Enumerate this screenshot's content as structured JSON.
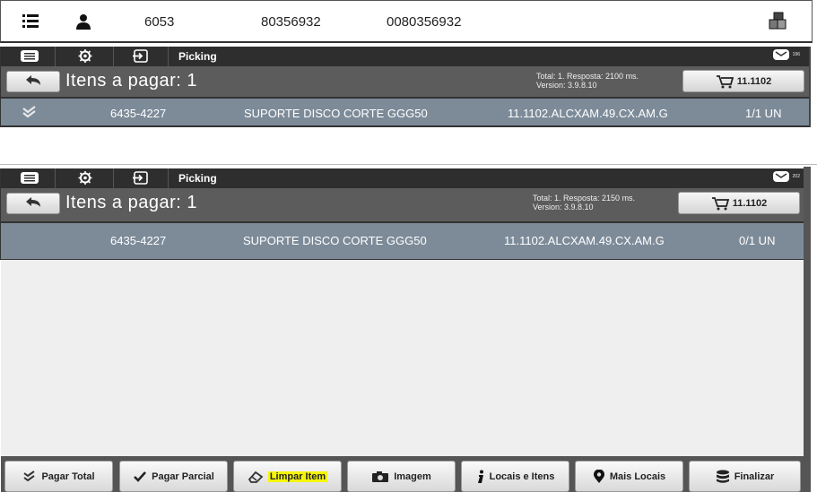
{
  "info_bar": {
    "field1": "6053",
    "field2": "80356932",
    "field3": "0080356932",
    "icons": [
      "list-icon",
      "user-icon",
      "boxes-icon"
    ]
  },
  "panel_top": {
    "toolbar": {
      "label": "Picking",
      "mail_count": "196"
    },
    "header": {
      "title": "Itens a pagar: 1",
      "stats_line1": "Total: 1. Resposta: 2100 ms.",
      "stats_line2": "Version: 3.9.8.10",
      "cart_label": "11.1102"
    },
    "row": {
      "code": "6435-4227",
      "description": "SUPORTE DISCO CORTE GGG50",
      "location": "11.1102.ALCXAM.49.CX.AM.G",
      "qty": "1/1 UN"
    }
  },
  "panel_bottom": {
    "toolbar": {
      "label": "Picking",
      "mail_count": "202"
    },
    "header": {
      "title": "Itens a pagar: 1",
      "stats_line1": "Total: 1. Resposta: 2150 ms.",
      "stats_line2": "Version: 3.9.8.10",
      "cart_label": "11.1102"
    },
    "row": {
      "code": "6435-4227",
      "description": "SUPORTE DISCO CORTE GGG50",
      "location": "11.1102.ALCXAM.49.CX.AM.G",
      "qty": "0/1 UN"
    }
  },
  "footer": {
    "buttons": [
      {
        "label": "Pagar Total",
        "icon": "double-check-icon"
      },
      {
        "label": "Pagar Parcial",
        "icon": "check-icon"
      },
      {
        "label": "Limpar Item",
        "icon": "eraser-icon",
        "highlight": "#f5f50a"
      },
      {
        "label": "Imagem",
        "icon": "camera-icon"
      },
      {
        "label": "Locais e Itens",
        "icon": "info-icon"
      },
      {
        "label": "Mais Locais",
        "icon": "map-pin-icon"
      },
      {
        "label": "Finalizar",
        "icon": "database-icon"
      }
    ]
  },
  "colors": {
    "row_bg": "#7d8b99",
    "toolbar_bg": "#2e2e2e",
    "header_bg": "#5c5c5c",
    "list_bg": "#efefef"
  }
}
